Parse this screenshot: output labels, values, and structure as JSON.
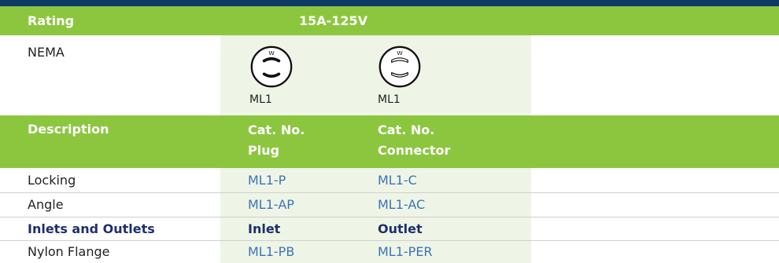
{
  "header": {
    "rating_label": "Rating",
    "rating_value": "15A-125V"
  },
  "nema": {
    "label": "NEMA",
    "plug_code": "ML1",
    "connector_code": "ML1"
  },
  "description_header": {
    "label": "Description",
    "col1_line1": "Cat. No.",
    "col1_line2": "Plug",
    "col2_line1": "Cat. No.",
    "col2_line2": "Connector"
  },
  "rows": [
    {
      "description": "Locking",
      "plug": "ML1-P",
      "connector": "ML1-C"
    },
    {
      "description": "Angle",
      "plug": "ML1-AP",
      "connector": "ML1-AC"
    }
  ],
  "inlets_section": {
    "label": "Inlets and Outlets",
    "col1": "Inlet",
    "col2": "Outlet"
  },
  "inlet_rows": [
    {
      "description": "Nylon Flange",
      "plug": "ML1-PB",
      "connector": "ML1-PER"
    }
  ],
  "colors": {
    "green": "#8cc63f",
    "navy": "#1e2f6e",
    "link": "#3b73b9",
    "topbar": "#0d3b66"
  },
  "icons": [
    "nema-ml1-plug-icon",
    "nema-ml1-connector-icon"
  ]
}
